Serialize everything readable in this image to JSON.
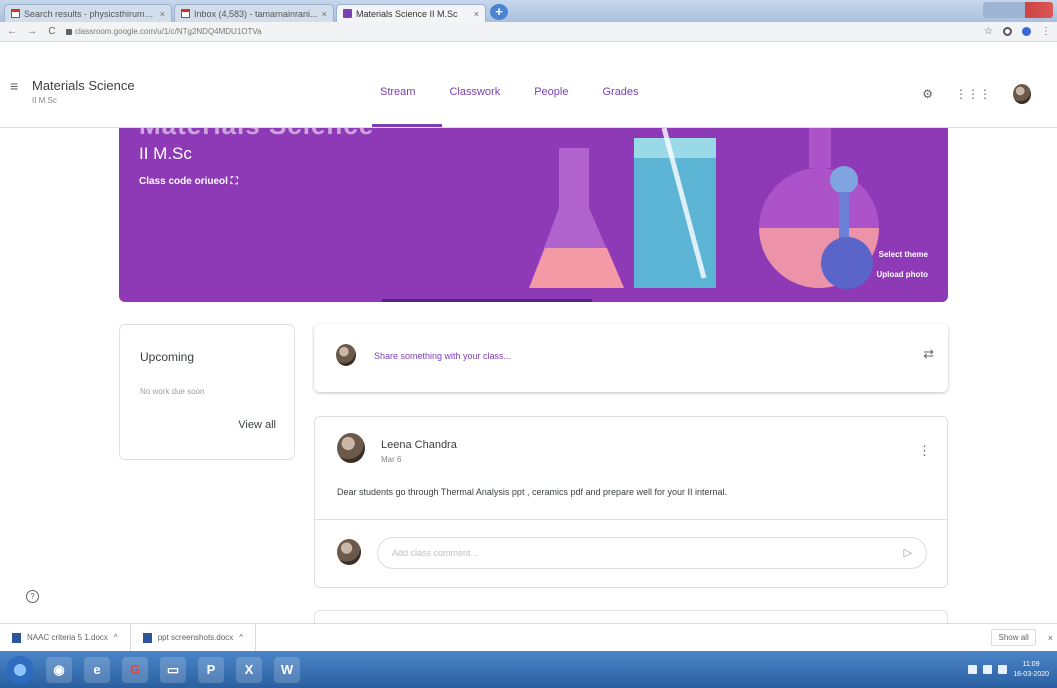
{
  "browser": {
    "tabs": [
      {
        "title": "Search results - physicsthirumu...",
        "icon": "gmail-icon"
      },
      {
        "title": "Inbox (4,583) - tamarnainrani...",
        "icon": "gmail-icon"
      },
      {
        "title": "Materials Science II M.Sc",
        "icon": "classroom-icon"
      }
    ],
    "url": "classroom.google.com/u/1/c/NTg2NDQ4MDU1OTVa"
  },
  "header": {
    "course_name": "Materials Science",
    "section": "II M.Sc",
    "nav": [
      "Stream",
      "Classwork",
      "People",
      "Grades"
    ],
    "active_nav": "Stream"
  },
  "banner": {
    "title_overflow": "Materials Science",
    "section": "II M.Sc",
    "class_code_label": "Class code",
    "class_code": "oriueol",
    "select_theme": "Select theme",
    "upload_photo": "Upload photo",
    "color": "#8e39b5"
  },
  "upcoming": {
    "heading": "Upcoming",
    "empty_text": "No work due soon",
    "view_all": "View all"
  },
  "share": {
    "placeholder": "Share something with your class..."
  },
  "post": {
    "author": "Leena Chandra",
    "date": "Mar 6",
    "body": "Dear students go through Thermal Analysis ppt , ceramics pdf and prepare well for your II internal.",
    "comment_placeholder": "Add class comment..."
  },
  "downloads": {
    "items": [
      "NAAC criteria 5 1.docx",
      "ppt screenshots.docx"
    ],
    "show_all": "Show all"
  },
  "taskbar": {
    "time": "11:09",
    "date": "16-03-2020"
  }
}
